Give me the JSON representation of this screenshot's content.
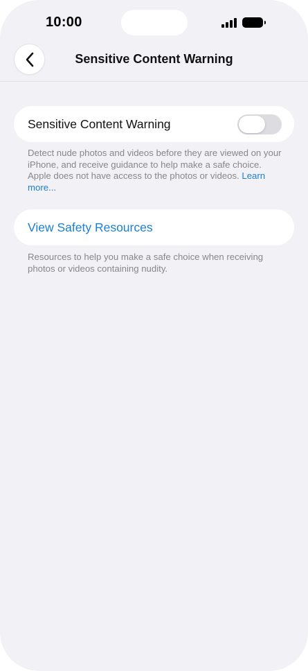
{
  "status_bar": {
    "time": "10:00",
    "signal_icon": "cellular-signal-icon",
    "battery_icon": "battery-icon"
  },
  "nav": {
    "back_icon": "chevron-left-icon",
    "title": "Sensitive Content Warning"
  },
  "settings": {
    "toggle_row": {
      "label": "Sensitive Content Warning",
      "enabled": false
    },
    "toggle_footnote": {
      "text": "Detect nude photos and videos before they are viewed on your iPhone, and receive guidance to help make a safe choice. Apple does not have access to the photos or videos. ",
      "link": "Learn more..."
    },
    "resources_row": {
      "label": "View Safety Resources"
    },
    "resources_footnote": "Resources to help you make a safe choice when receiving photos or videos containing nudity."
  },
  "colors": {
    "background": "#f1f1f6",
    "accent": "#1a7fd0",
    "toggle_off": "#dcdce1"
  }
}
